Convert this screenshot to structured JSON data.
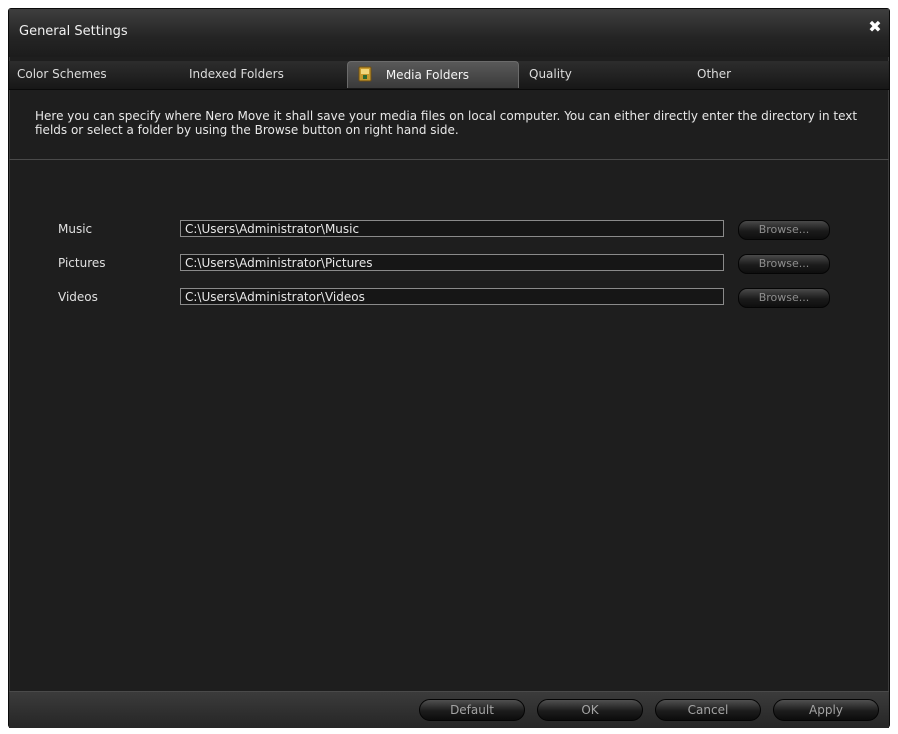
{
  "window": {
    "title": "General Settings",
    "close_symbol": "✖"
  },
  "tabs": [
    {
      "label": "Color Schemes",
      "active": false
    },
    {
      "label": "Indexed Folders",
      "active": false
    },
    {
      "label": "Media Folders",
      "active": true,
      "icon": "folder-icon"
    },
    {
      "label": "Quality",
      "active": false
    },
    {
      "label": "Other",
      "active": false
    }
  ],
  "description": "Here you can specify where Nero Move it shall save your media files on local computer. You can either directly enter the directory in text fields or select a folder by using the Browse button on right hand side.",
  "folders": [
    {
      "label": "Music",
      "path": "C:\\Users\\Administrator\\Music",
      "browse_label": "Browse..."
    },
    {
      "label": "Pictures",
      "path": "C:\\Users\\Administrator\\Pictures",
      "browse_label": "Browse..."
    },
    {
      "label": "Videos",
      "path": "C:\\Users\\Administrator\\Videos",
      "browse_label": "Browse..."
    }
  ],
  "footer": {
    "default_label": "Default",
    "ok_label": "OK",
    "cancel_label": "Cancel",
    "apply_label": "Apply"
  }
}
